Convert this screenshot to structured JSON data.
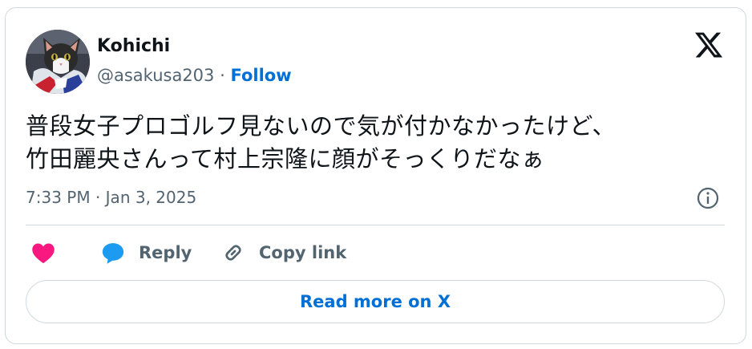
{
  "author": {
    "name": "Kohichi",
    "handle": "@asakusa203",
    "separator": "·",
    "follow_label": "Follow"
  },
  "tweet": {
    "text": "普段女子プロゴルフ見ないので気が付かなかったけど、\n竹田麗央さんって村上宗隆に顔がそっくりだなぁ",
    "timestamp": "7:33 PM · Jan 3, 2025"
  },
  "actions": {
    "like_icon": "heart-icon",
    "reply_label": "Reply",
    "copy_link_label": "Copy link"
  },
  "read_more_label": "Read more on X",
  "colors": {
    "accent": "#006fd6",
    "like": "#f91880",
    "reply": "#1d9bf0",
    "muted": "#536471",
    "border": "#cfd9de"
  }
}
